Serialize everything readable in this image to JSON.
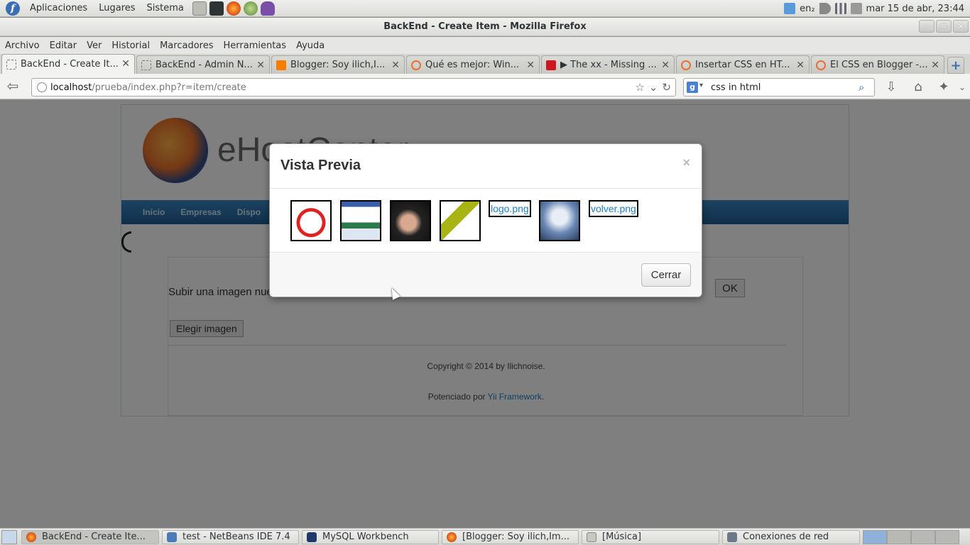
{
  "top_panel": {
    "menus": [
      "Aplicaciones",
      "Lugares",
      "Sistema"
    ],
    "tray_lang": "en₂",
    "clock": "mar 15 de abr, 23:44"
  },
  "window": {
    "title": "BackEnd - Create Item - Mozilla Firefox"
  },
  "menubar": [
    "Archivo",
    "Editar",
    "Ver",
    "Historial",
    "Marcadores",
    "Herramientas",
    "Ayuda"
  ],
  "tabs": [
    {
      "label": "BackEnd - Create It...",
      "active": true
    },
    {
      "label": "BackEnd - Admin N..."
    },
    {
      "label": "Blogger: Soy ilich,I..."
    },
    {
      "label": "Qué es mejor: Win..."
    },
    {
      "label": "▶ The xx - Missing ..."
    },
    {
      "label": "Insertar CSS en HT..."
    },
    {
      "label": "El CSS en Blogger -..."
    }
  ],
  "url": {
    "host": "localhost",
    "path": "/prueba/index.php?r=item/create"
  },
  "search": {
    "value": "css in html"
  },
  "site": {
    "brand": "eHostCenter",
    "nav": [
      "Inicio",
      "Empresas",
      "Dispo"
    ],
    "upload_label": "Subir una imagen nue",
    "ok_label": "OK",
    "choose_label": "Elegir imagen",
    "copyright": "Copyright © 2014 by Ilichnoise.",
    "powered_prefix": "Potenciado por ",
    "powered_link": "Yii Framework",
    "powered_suffix": "."
  },
  "modal": {
    "title": "Vista Previa",
    "close_glyph": "×",
    "images": [
      {
        "kind": "thumb",
        "icon": "alarm-clock-image"
      },
      {
        "kind": "thumb",
        "icon": "screenshot-image"
      },
      {
        "kind": "thumb",
        "icon": "portrait-photo-image"
      },
      {
        "kind": "thumb",
        "icon": "green-arrow-image"
      },
      {
        "kind": "link",
        "label": "logo.png"
      },
      {
        "kind": "thumb",
        "icon": "desktop-screenshot-image"
      },
      {
        "kind": "link",
        "label": "volver.png"
      }
    ],
    "close_button": "Cerrar"
  },
  "taskbar": [
    {
      "label": "BackEnd - Create Ite...",
      "icon": "firefox-icon",
      "active": true
    },
    {
      "label": "test - NetBeans IDE 7.4",
      "icon": "netbeans-icon"
    },
    {
      "label": "MySQL Workbench",
      "icon": "mysql-workbench-icon"
    },
    {
      "label": "[Blogger: Soy ilich,Im...",
      "icon": "firefox-icon"
    },
    {
      "label": "[Música]",
      "icon": "folder-icon"
    },
    {
      "label": "Conexiones de red",
      "icon": "network-icon"
    }
  ]
}
